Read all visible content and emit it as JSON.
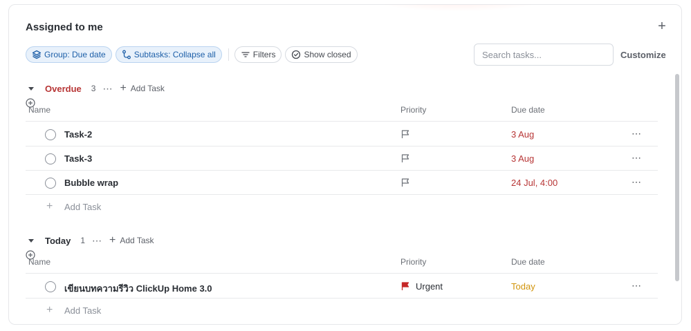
{
  "panel": {
    "title": "Assigned to me"
  },
  "toolbar": {
    "group_label": "Group: Due date",
    "subtasks_label": "Subtasks: Collapse all",
    "filters_label": "Filters",
    "show_closed_label": "Show closed",
    "search_placeholder": "Search tasks...",
    "customize_label": "Customize"
  },
  "columns": {
    "name": "Name",
    "priority": "Priority",
    "due_date": "Due date"
  },
  "groups": [
    {
      "name": "Overdue",
      "count": "3",
      "add_task_label": "Add Task",
      "tasks": [
        {
          "name": "Task-2",
          "priority": "",
          "due": "3 Aug"
        },
        {
          "name": "Task-3",
          "priority": "",
          "due": "3 Aug"
        },
        {
          "name": "Bubble wrap",
          "priority": "",
          "due": "24 Jul, 4:00"
        }
      ],
      "add_row_label": "Add Task"
    },
    {
      "name": "Today",
      "count": "1",
      "add_task_label": "Add Task",
      "tasks": [
        {
          "name": "เขียนบทความรีวิว ClickUp Home 3.0",
          "priority": "Urgent",
          "due": "Today"
        }
      ],
      "add_row_label": "Add Task"
    }
  ],
  "colors": {
    "overdue_red": "#b73535",
    "today_amber": "#d1940c",
    "urgent_flag": "#c62828",
    "chip_blue": "#1d5fa8"
  },
  "icons": [
    "layers-icon",
    "subtasks-icon",
    "filter-icon",
    "check-circle-icon",
    "plus-icon",
    "flag-icon",
    "ellipsis-icon",
    "plus-circle-icon",
    "caret-down-icon"
  ]
}
